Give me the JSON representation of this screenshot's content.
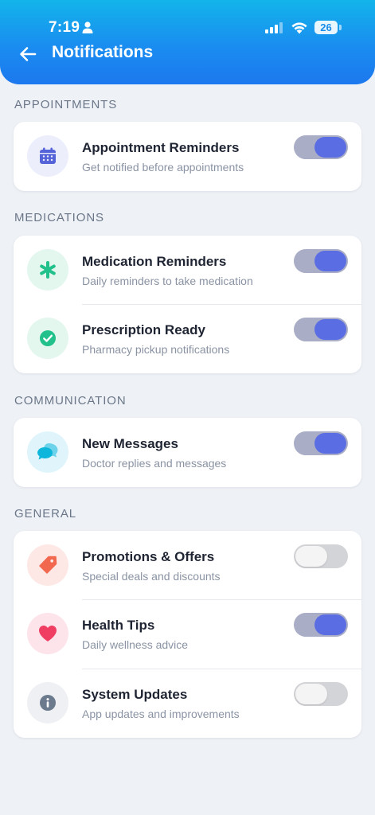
{
  "status_bar": {
    "time": "7:19",
    "battery": "26"
  },
  "header": {
    "title": "Notifications"
  },
  "sections": [
    {
      "label": "APPOINTMENTS",
      "items": [
        {
          "title": "Appointment Reminders",
          "subtitle": "Get notified before appointments",
          "enabled": true,
          "icon": "calendar-icon"
        }
      ]
    },
    {
      "label": "MEDICATIONS",
      "items": [
        {
          "title": "Medication Reminders",
          "subtitle": "Daily reminders to take medication",
          "enabled": true,
          "icon": "asterisk-icon"
        },
        {
          "title": "Prescription Ready",
          "subtitle": "Pharmacy pickup notifications",
          "enabled": true,
          "icon": "check-circle-icon"
        }
      ]
    },
    {
      "label": "COMMUNICATION",
      "items": [
        {
          "title": "New Messages",
          "subtitle": "Doctor replies and messages",
          "enabled": true,
          "icon": "chat-bubbles-icon"
        }
      ]
    },
    {
      "label": "GENERAL",
      "items": [
        {
          "title": "Promotions & Offers",
          "subtitle": "Special deals and discounts",
          "enabled": false,
          "icon": "tag-icon"
        },
        {
          "title": "Health Tips",
          "subtitle": "Daily wellness advice",
          "enabled": true,
          "icon": "heart-icon"
        },
        {
          "title": "System Updates",
          "subtitle": "App updates and improvements",
          "enabled": false,
          "icon": "info-icon"
        }
      ]
    }
  ],
  "colors": {
    "header_gradient_top": "#12b4ea",
    "header_gradient_bottom": "#1c78ee",
    "toggle_on_track": "#a9adc6",
    "toggle_on_knob": "#5b6de3",
    "toggle_off_track": "#d3d4d7"
  }
}
